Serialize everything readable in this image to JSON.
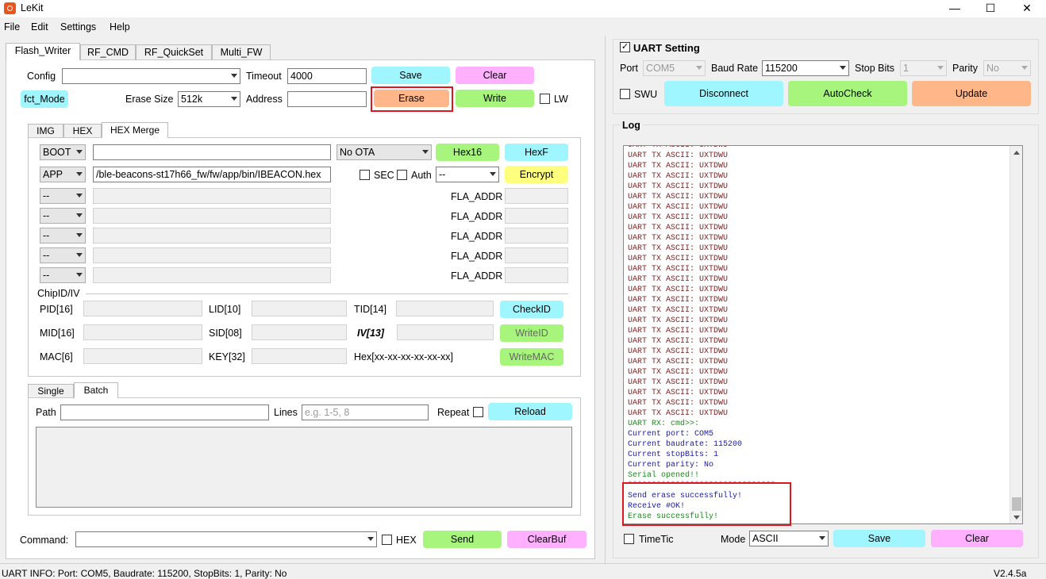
{
  "window": {
    "title": "LeKit",
    "minimize": "—",
    "maximize": "☐",
    "close": "✕",
    "icon": "lekit-app-icon"
  },
  "menu": [
    "File",
    "Edit",
    "Settings",
    "Help"
  ],
  "tabs": [
    "Flash_Writer",
    "RF_CMD",
    "RF_QuickSet",
    "Multi_FW"
  ],
  "config": {
    "config_label": "Config",
    "config_value": "",
    "timeout_label": "Timeout",
    "timeout_value": "4000",
    "save": "Save",
    "clear": "Clear",
    "fct_mode": "fct_Mode",
    "erase_size_label": "Erase Size",
    "erase_size_value": "512k",
    "address_label": "Address",
    "address_value": "",
    "erase": "Erase",
    "write": "Write",
    "lw": "LW"
  },
  "subtabs": [
    "IMG",
    "HEX",
    "HEX Merge"
  ],
  "hex": {
    "boot": "BOOT",
    "boot_path": "",
    "ota": "No OTA",
    "hex16": "Hex16",
    "hexf": "HexF",
    "app": "APP",
    "app_path": "/ble-beacons-st17h66_fw/fw/app/bin/IBEACON.hex",
    "sec": "SEC",
    "auth": "Auth",
    "auth_value": "--",
    "encrypt": "Encrypt",
    "placeholder_slot": "--",
    "fla_addr": "FLA_ADDR"
  },
  "chip": {
    "title": "ChipID/IV",
    "pid": "PID[16]",
    "lid": "LID[10]",
    "tid": "TID[14]",
    "checkid": "CheckID",
    "mid": "MID[16]",
    "sid": "SID[08]",
    "iv": "IV[13]",
    "writeid": "WriteID",
    "mac": "MAC[6]",
    "key": "KEY[32]",
    "hexfmt": "Hex[xx-xx-xx-xx-xx-xx]",
    "writemac": "WriteMAC"
  },
  "batch": {
    "tabs": [
      "Single",
      "Batch"
    ],
    "path_label": "Path",
    "path_value": "",
    "lines_label": "Lines",
    "lines_placeholder": "e.g. 1-5, 8",
    "repeat": "Repeat",
    "reload": "Reload"
  },
  "command": {
    "label": "Command:",
    "value": "",
    "hex": "HEX",
    "send": "Send",
    "clearbuf": "ClearBuf"
  },
  "uart": {
    "title": "UART Setting",
    "port_label": "Port",
    "port_value": "COM5",
    "baud_label": "Baud Rate",
    "baud_value": "115200",
    "stop_label": "Stop Bits",
    "stop_value": "1",
    "parity_label": "Parity",
    "parity_value": "No",
    "swu": "SWU",
    "disconnect": "Disconnect",
    "autocheck": "AutoCheck",
    "update": "Update"
  },
  "log": {
    "title": "Log",
    "tx_line": "UART TX ASCII: UXTDWU",
    "rx_line": "UART RX: cmd>>:",
    "port": "Current port: COM5",
    "baud": "Current baudrate: 115200",
    "stop": "Current stopBits: 1",
    "parity": "Current parity: No",
    "opened": "Serial opened!!",
    "stars": "*******************************",
    "send_erase": "Send erase successfully!",
    "receive_ok": "Receive #OK!",
    "erase_ok": "Erase successfully!"
  },
  "logfoot": {
    "timetic": "TimeTic",
    "mode_label": "Mode",
    "mode_value": "ASCII",
    "save": "Save",
    "clear": "Clear"
  },
  "status": {
    "info": "UART INFO: Port: COM5, Baudrate: 115200, StopBits: 1, Parity: No",
    "version": "V2.4.5a"
  },
  "colors": {
    "highlight": "#e0161f",
    "log_tx": "#7a1f1f",
    "log_green": "#1b8a1b",
    "log_blue": "#1a1aa0"
  }
}
